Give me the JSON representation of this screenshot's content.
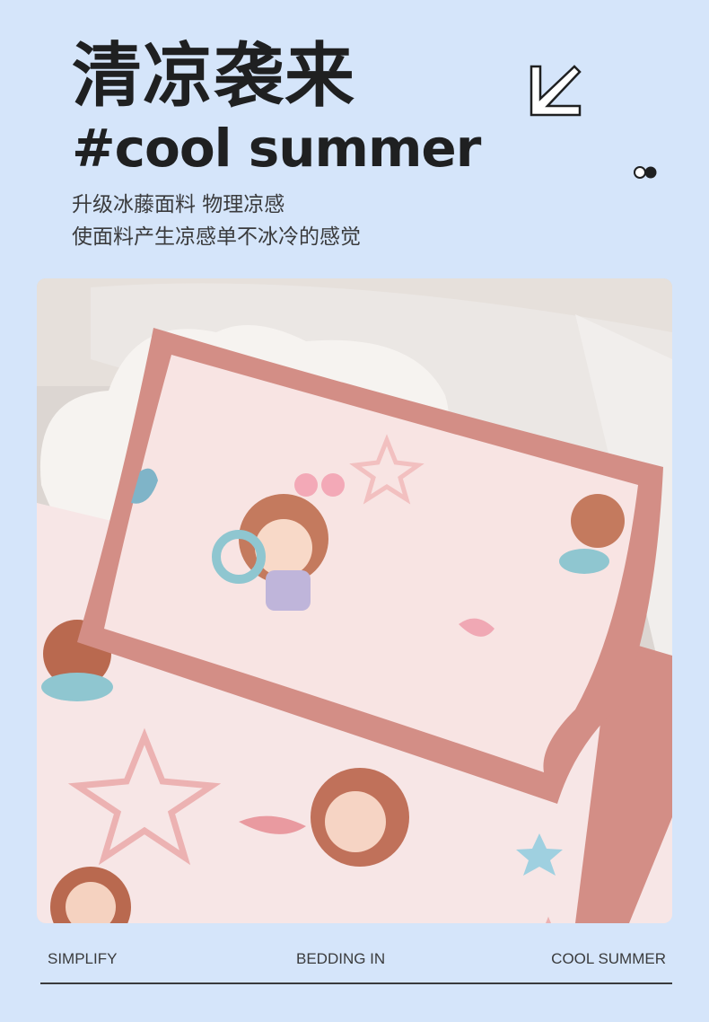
{
  "header": {
    "title": "清凉袭来",
    "subtitle": "#cool summer",
    "description_line1": "升级冰藤面料 物理凉感",
    "description_line2": "使面料产生凉感单不冰冷的感觉"
  },
  "icons": {
    "arrow": "arrow-down-left-icon",
    "dots": "dots-icon"
  },
  "photo": {
    "subject": "pillow-and-mat-photo"
  },
  "footer": {
    "left": "SIMPLIFY",
    "middle": "BEDDING IN",
    "right": "COOL SUMMER"
  },
  "colors": {
    "background": "#d5e5fa",
    "text": "#1f2021",
    "pillow_border": "#d38e86",
    "mat": "#f7e6e6"
  }
}
